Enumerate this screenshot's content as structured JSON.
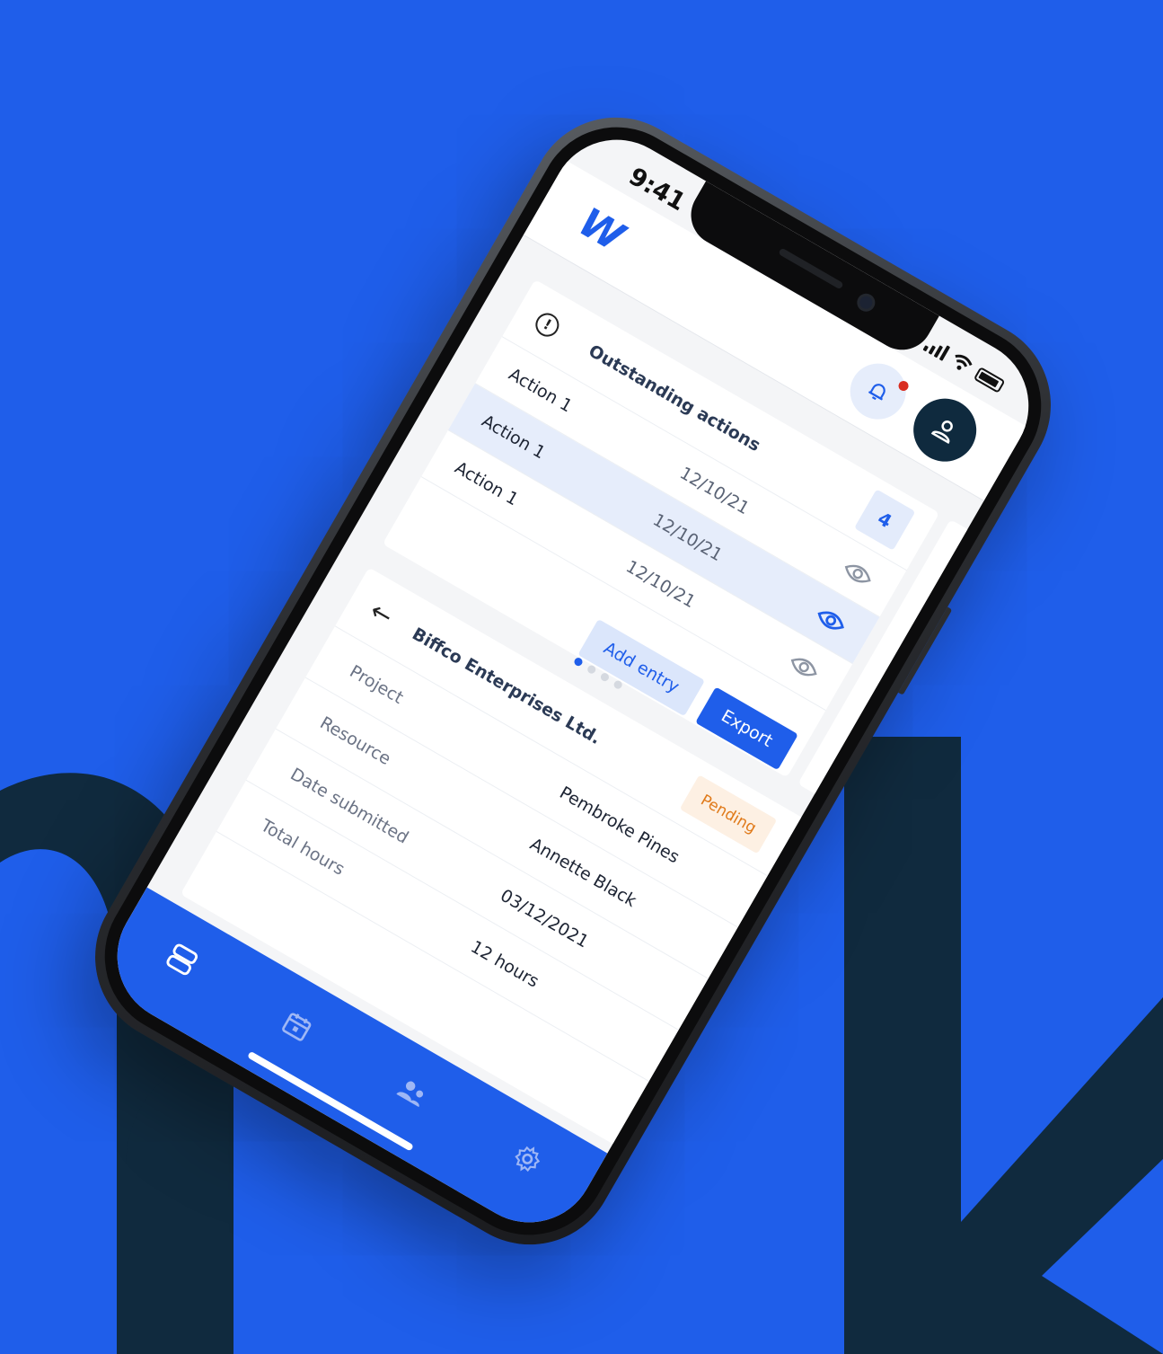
{
  "status_bar": {
    "time": "9:41"
  },
  "header": {
    "logo": "W"
  },
  "actions_card": {
    "title": "Outstanding actions",
    "count": "4",
    "rows": [
      {
        "name": "Action 1",
        "date": "12/10/21"
      },
      {
        "name": "Action 1",
        "date": "12/10/21"
      },
      {
        "name": "Action 1",
        "date": "12/10/21"
      }
    ],
    "add_entry_label": "Add entry",
    "export_label": "Export"
  },
  "details_card": {
    "company": "Biffco Enterprises Ltd.",
    "status": "Pending",
    "rows": [
      {
        "label": "Project",
        "value": "Pembroke Pines"
      },
      {
        "label": "Resource",
        "value": "Annette Black"
      },
      {
        "label": "Date submitted",
        "value": "03/12/2021"
      },
      {
        "label": "Total hours",
        "value": "12 hours"
      }
    ]
  },
  "bottom_nav": {
    "items": [
      "dashboard-icon",
      "calendar-icon",
      "people-icon",
      "settings-icon"
    ]
  },
  "colors": {
    "brand": "#1f5eea",
    "navy": "#0f2a3e",
    "pending": "#e07a1a",
    "notification": "#d92d20"
  }
}
